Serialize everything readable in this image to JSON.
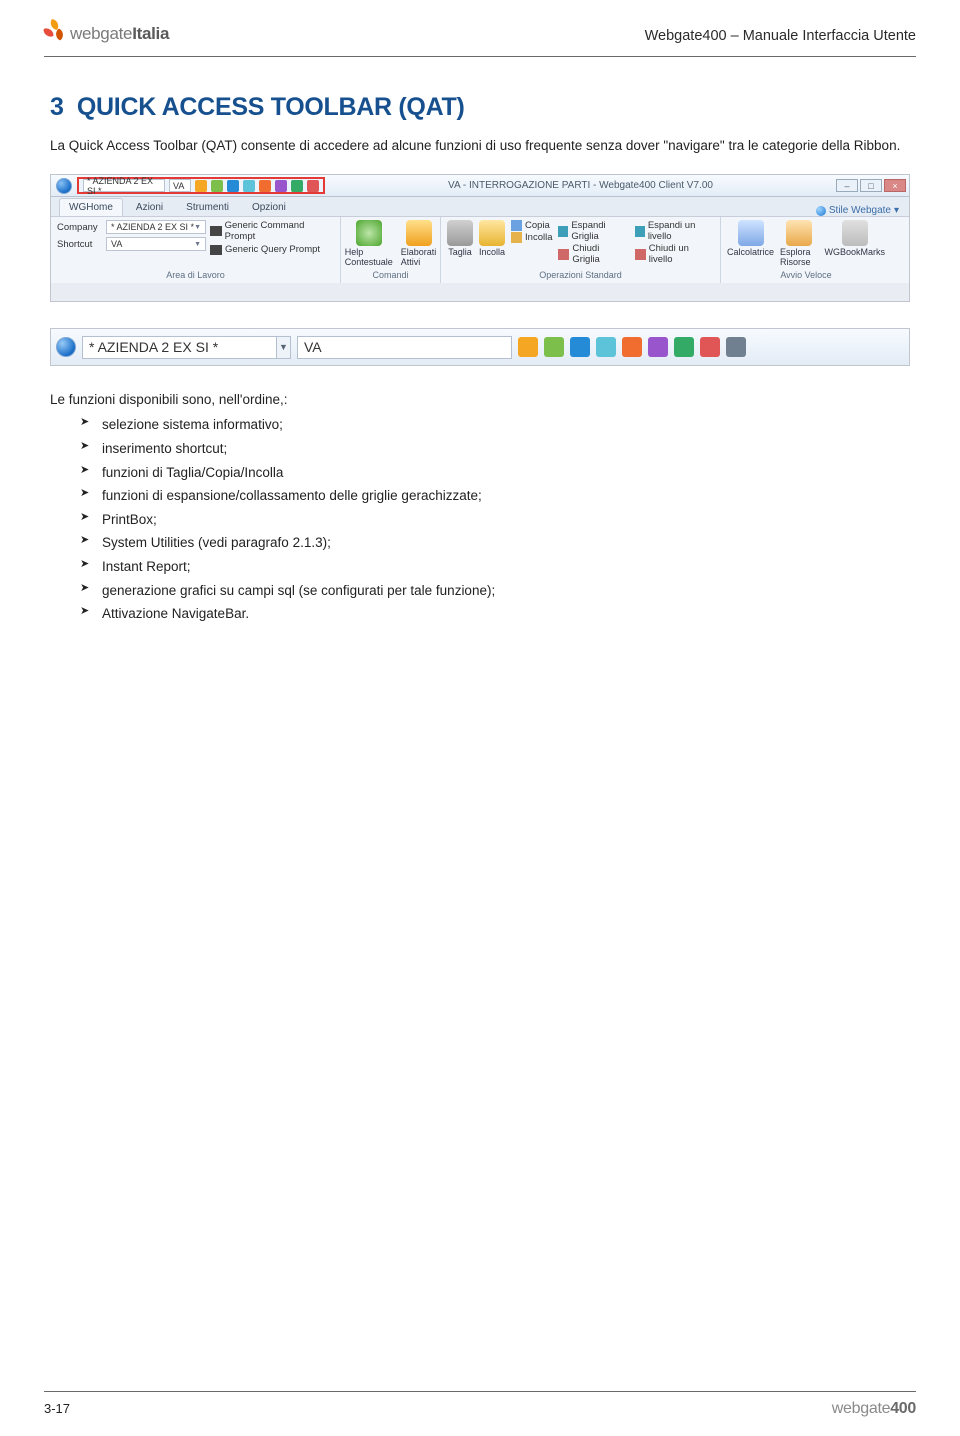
{
  "header": {
    "logo_text_a": "webgate",
    "logo_text_b": "Italia",
    "doc_title": "Webgate400 – Manuale Interfaccia Utente"
  },
  "section": {
    "number": "3",
    "title": "QUICK ACCESS TOOLBAR (QAT)",
    "intro": "La Quick Access Toolbar (QAT) consente di accedere ad alcune funzioni di uso frequente senza dover \"navigare\" tra le categorie della Ribbon."
  },
  "screenshot1": {
    "qat_field1": "* AZIENDA 2 EX SI *",
    "qat_field2": "VA",
    "window_title": "VA - INTERROGAZIONE PARTI - Webgate400 Client V7.00",
    "tabs": [
      "WGHome",
      "Azioni",
      "Strumenti",
      "Opzioni"
    ],
    "style_link": "Stile Webgate",
    "group_area": {
      "company_label": "Company",
      "company_value": "* AZIENDA 2 EX SI *",
      "shortcut_label": "Shortcut",
      "shortcut_value": "VA",
      "cmd1": "Generic Command Prompt",
      "cmd2": "Generic Query Prompt",
      "name": "Area di Lavoro"
    },
    "group_cmd": {
      "help_label": "Help Contestuale",
      "elab_label": "Elaborati Attivi",
      "name": "Comandi"
    },
    "group_ops": {
      "cut": "Taglia",
      "paste_big": "Incolla",
      "copy": "Copia",
      "paste": "Incolla",
      "exp_grid": "Espandi Griglia",
      "col_grid": "Chiudi Griglia",
      "exp_lvl": "Espandi un livello",
      "col_lvl": "Chiudi un livello",
      "name": "Operazioni Standard"
    },
    "group_quick": {
      "calc": "Calcolatrice",
      "explore": "Esplora Risorse",
      "book": "WGBookMarks",
      "name": "Avvio Veloce"
    }
  },
  "screenshot2": {
    "field1": "* AZIENDA 2 EX SI  *",
    "field2": "VA"
  },
  "list": {
    "intro": "Le funzioni disponibili sono, nell'ordine,:",
    "items": [
      "selezione sistema informativo;",
      "inserimento shortcut;",
      "funzioni di Taglia/Copia/Incolla",
      "funzioni di espansione/collassamento delle griglie gerachizzate;",
      "PrintBox;",
      "System Utilities (vedi paragrafo 2.1.3);",
      "Instant Report;",
      "generazione grafici su campi sql (se configurati per tale funzione);",
      "Attivazione NavigateBar."
    ]
  },
  "footer": {
    "page": "3-17",
    "logo_text_a": "webgate",
    "logo_text_b": "400"
  }
}
